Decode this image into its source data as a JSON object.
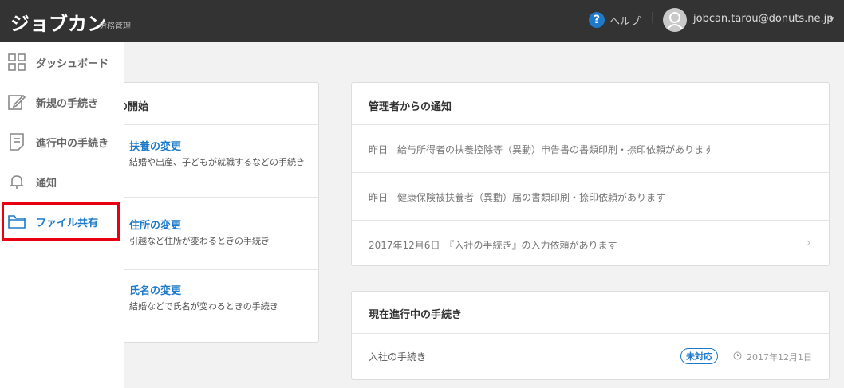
{
  "header": {
    "logo": "ジョブカン",
    "logo_sub": "労務管理",
    "help_icon": "?",
    "help_label": "ヘルプ",
    "separator": "|",
    "user_email": "jobcan.tarou@donuts.ne.jp",
    "caret": "▾"
  },
  "sidebar": {
    "items": [
      {
        "label": "ダッシュボード",
        "icon": "grid-icon"
      },
      {
        "label": "新規の手続き",
        "icon": "edit-icon"
      },
      {
        "label": "進行中の手続き",
        "icon": "document-icon"
      },
      {
        "label": "通知",
        "icon": "bell-icon"
      },
      {
        "label": "ファイル共有",
        "icon": "folder-icon",
        "active": true
      }
    ]
  },
  "left_card": {
    "title": "の開始",
    "items": [
      {
        "title": "扶養の変更",
        "desc": "結婚や出産、子どもが就職するなどの手続き"
      },
      {
        "title": "住所の変更",
        "desc": "引越など住所が変わるときの手続き"
      },
      {
        "title": "氏名の変更",
        "desc": "結婚などで氏名が変わるときの手続き"
      }
    ]
  },
  "notice_card": {
    "title": "管理者からの通知",
    "rows": [
      {
        "text": "昨日　給与所得者の扶養控除等（異動）申告書の書類印刷・捺印依頼があります"
      },
      {
        "text": "昨日　健康保険被扶養者（異動）届の書類印刷・捺印依頼があります"
      },
      {
        "text": "2017年12月6日　『入社の手続き』の入力依頼があります"
      }
    ],
    "arrow": "›"
  },
  "progress_card": {
    "title": "現在進行中の手続き",
    "row_text": "入社の手続き",
    "badge": "未対応",
    "date": "2017年12月1日"
  },
  "colors": {
    "header_bg": "#333333",
    "accent": "#1e7ac8",
    "highlight": "#e60012"
  }
}
